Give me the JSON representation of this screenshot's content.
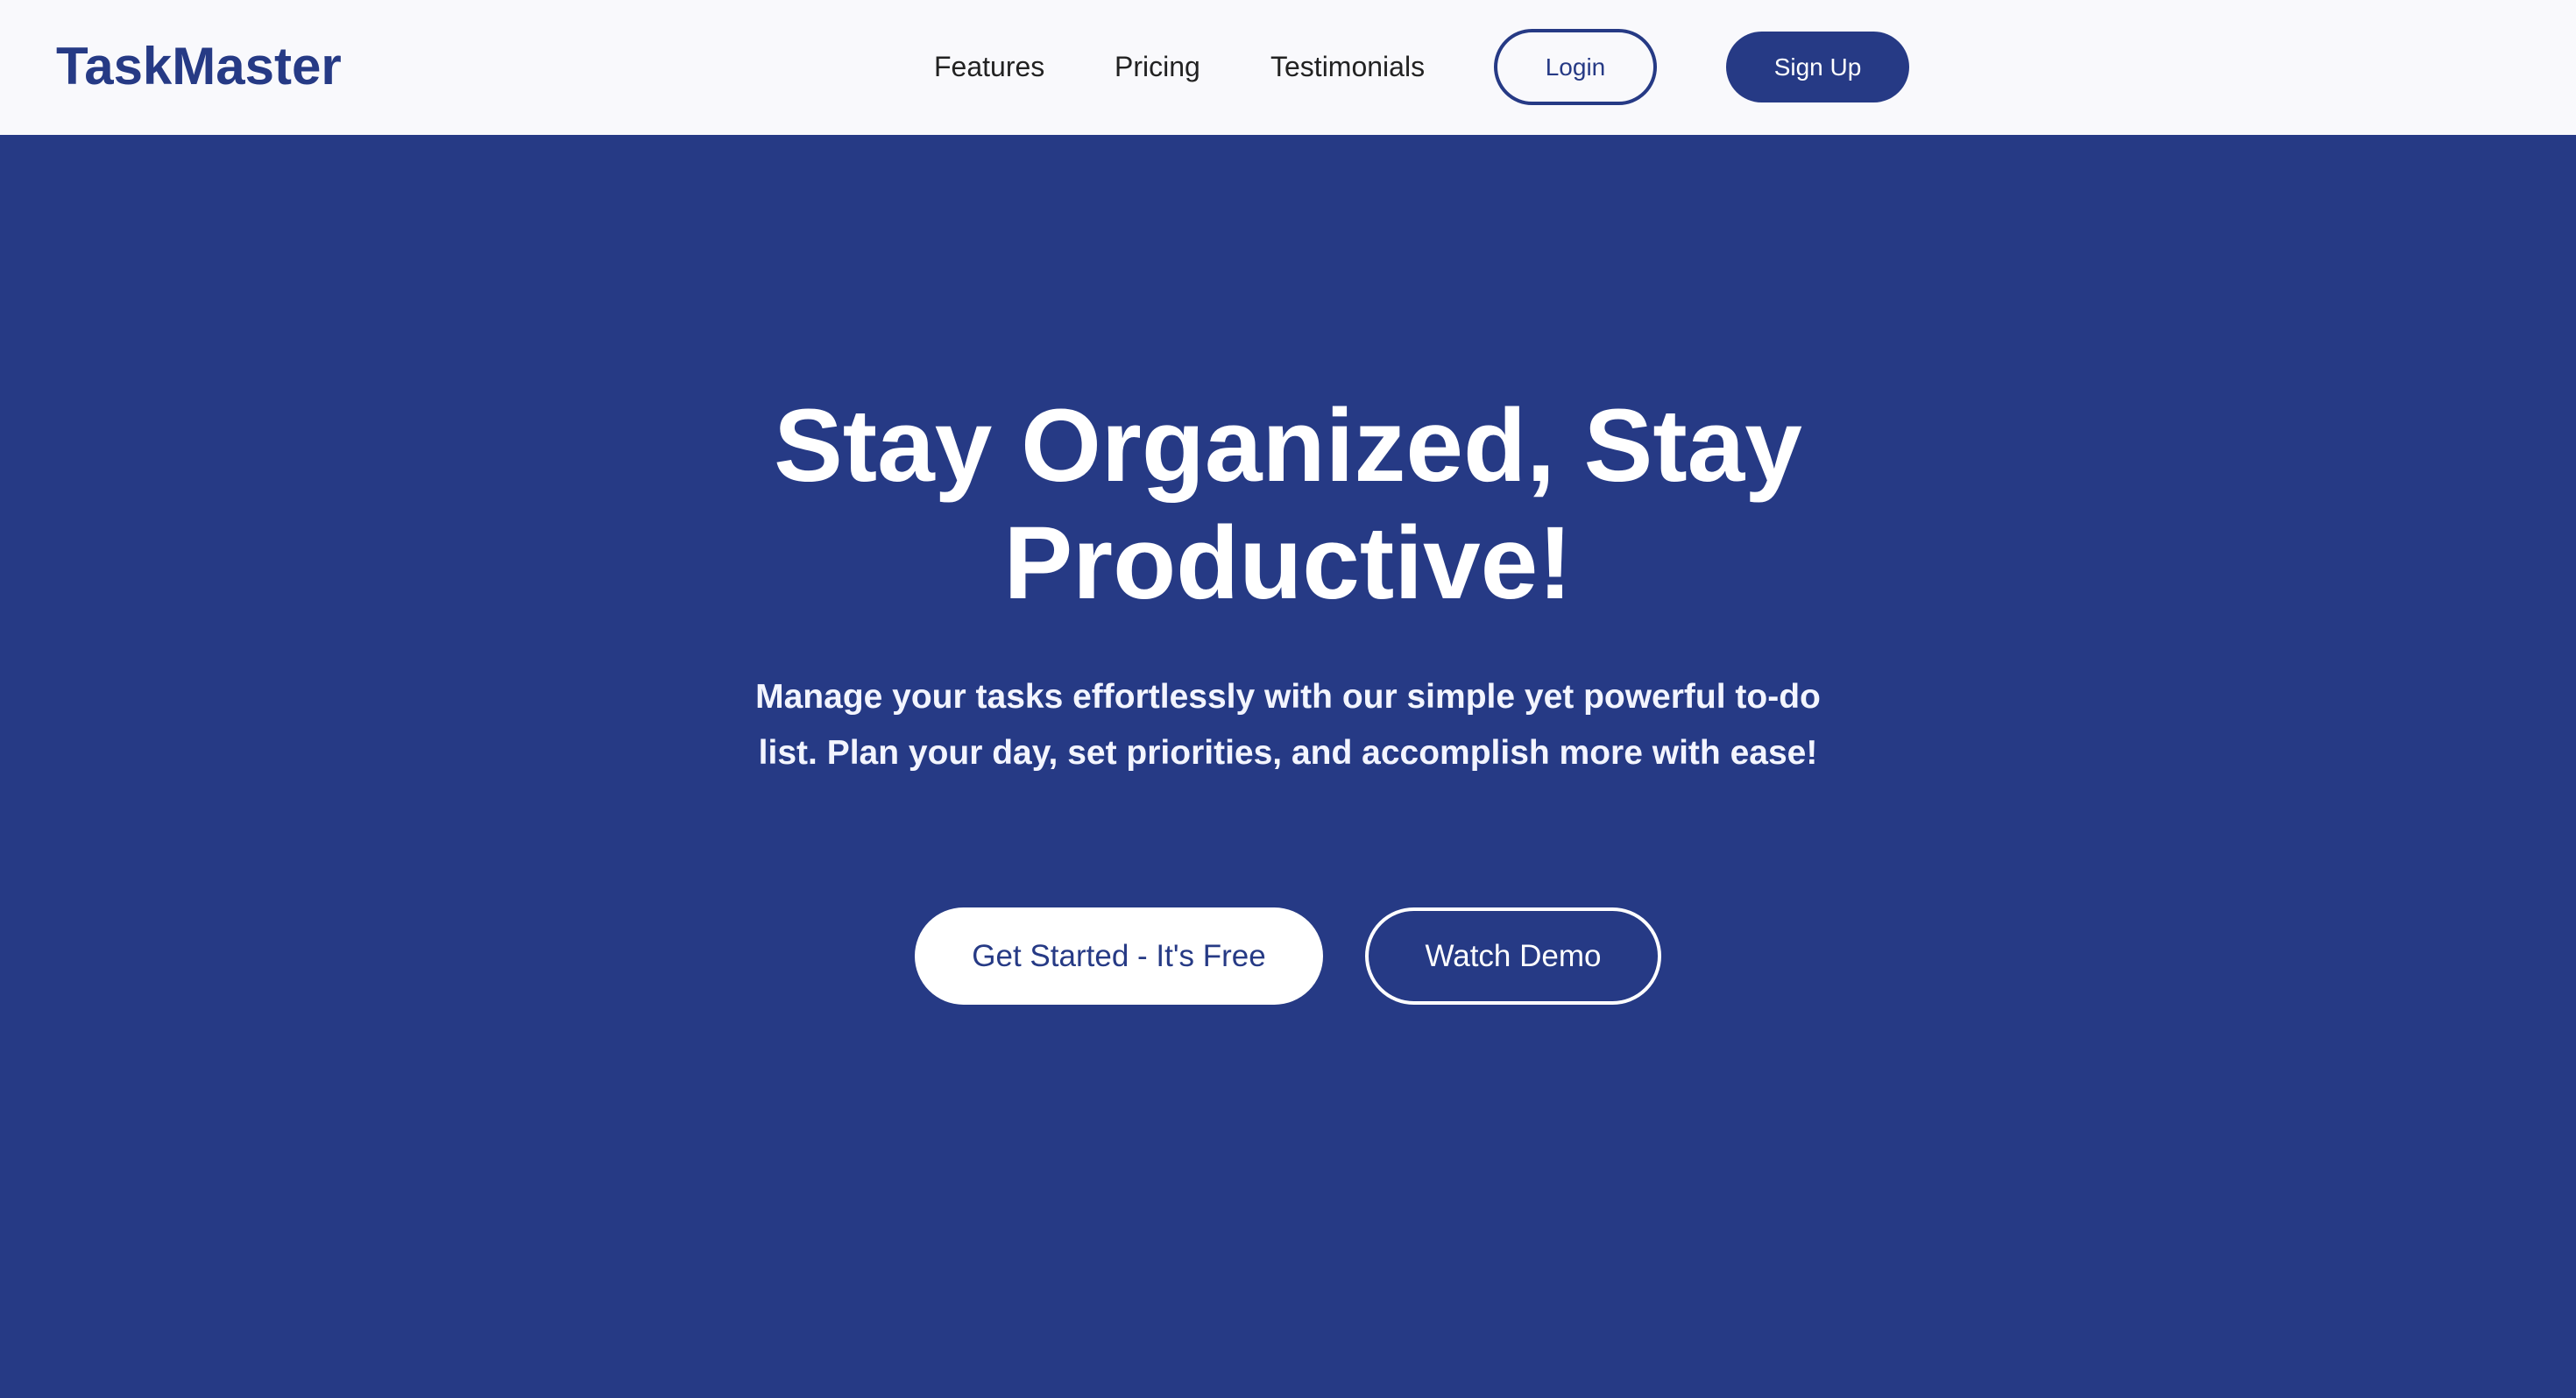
{
  "brand": {
    "name": "TaskMaster",
    "primary_color": "#263a85",
    "nav_background": "#f9f9fc",
    "text_color": "#222222",
    "on_primary_text": "#ffffff"
  },
  "nav": {
    "links": [
      {
        "label": "Features"
      },
      {
        "label": "Pricing"
      },
      {
        "label": "Testimonials"
      }
    ],
    "login_label": "Login",
    "signup_label": "Sign Up"
  },
  "hero": {
    "title": "Stay Organized, Stay Productive!",
    "subtitle": "Manage your tasks effortlessly with our simple yet powerful to-do list. Plan your day, set priorities, and accomplish more with ease!",
    "primary_cta": "Get Started - It's Free",
    "secondary_cta": "Watch Demo"
  }
}
